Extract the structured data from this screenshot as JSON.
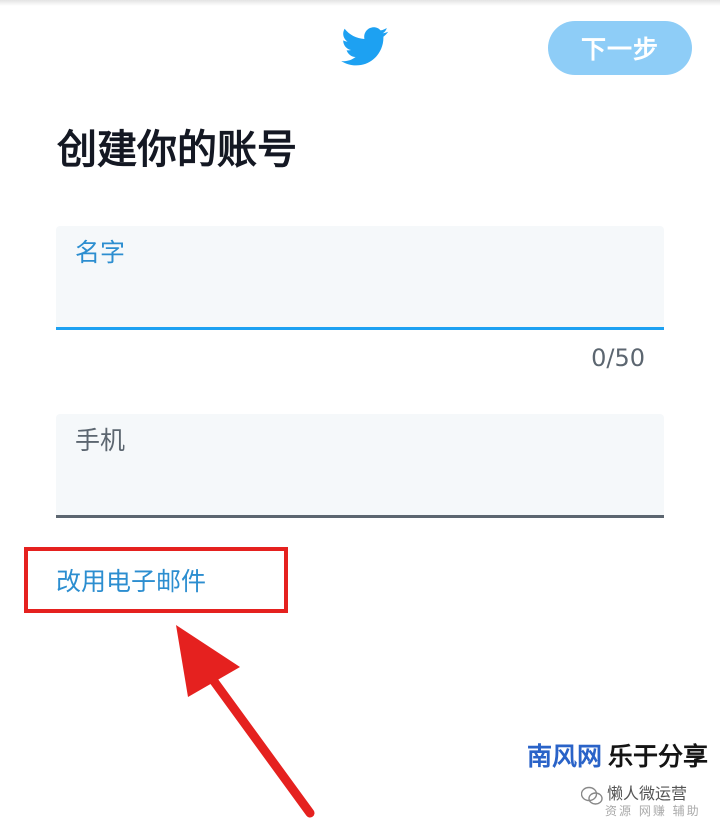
{
  "header": {
    "logo_icon": "twitter-bird-icon",
    "next_label": "下一步"
  },
  "page": {
    "title": "创建你的账号"
  },
  "form": {
    "name_label": "名字",
    "name_value": "",
    "name_counter": "0/50",
    "phone_label": "手机",
    "phone_value": "",
    "use_email_label": "改用电子邮件"
  },
  "annotation": {
    "highlight_color": "#e5211f",
    "arrow_icon": "red-arrow-icon"
  },
  "watermark": {
    "brand_part1": "南风网",
    "brand_part2": "乐于分享",
    "account": "懒人微运营",
    "tagline": "资源 网赚 辅助",
    "icon": "wechat-icon"
  },
  "colors": {
    "accent": "#1da1f2",
    "button_disabled": "#8ecdf7",
    "link": "#2c8ed0"
  }
}
